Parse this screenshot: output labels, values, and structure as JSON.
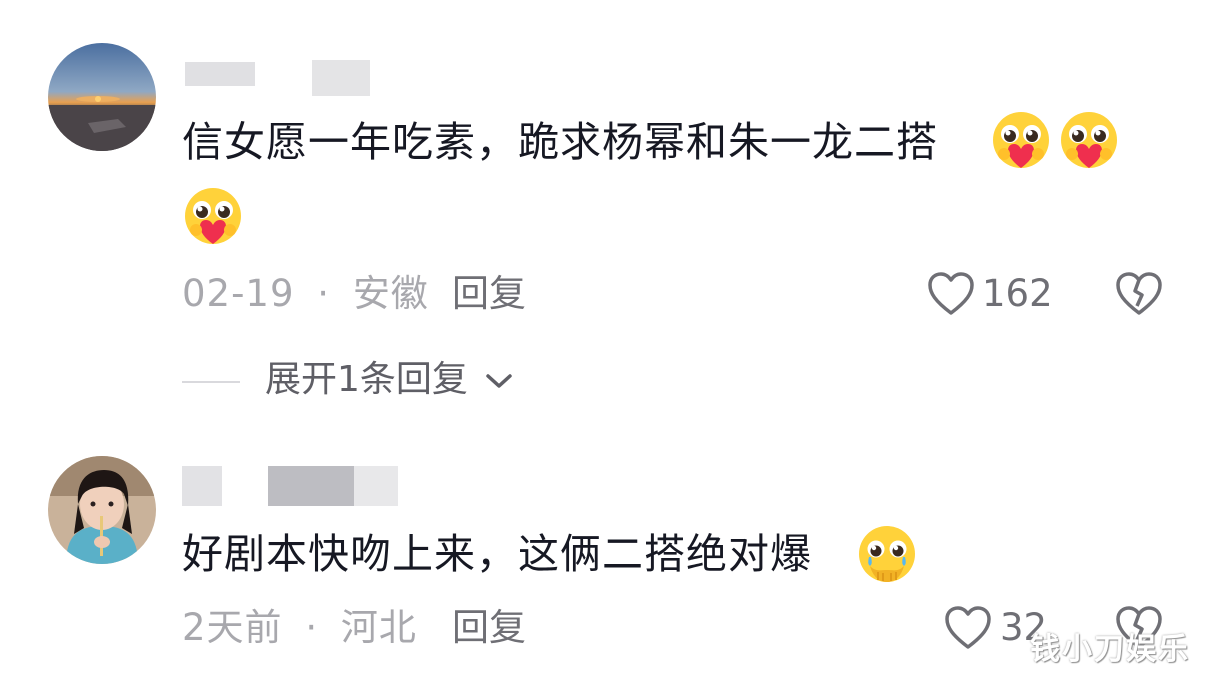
{
  "comments": [
    {
      "text": "信女愿一年吃素，跪求杨幂和朱一龙二搭",
      "emoji": "pleading-face-holding-heart",
      "date": "02-19",
      "separator": "·",
      "location": "安徽",
      "reply_label": "回复",
      "likes": "162",
      "expand_replies": "展开1条回复"
    },
    {
      "text": "好剧本快吻上来，这俩二搭绝对爆",
      "emoji": "face-holding-back-tears",
      "date": "2天前",
      "separator": "·",
      "location": "河北",
      "reply_label": "回复",
      "likes": "32"
    }
  ],
  "watermark": "钱小刀娱乐",
  "colors": {
    "text": "#161823",
    "meta": "#a8a8ad",
    "secondary": "#6f6f75",
    "background": "#ffffff"
  }
}
